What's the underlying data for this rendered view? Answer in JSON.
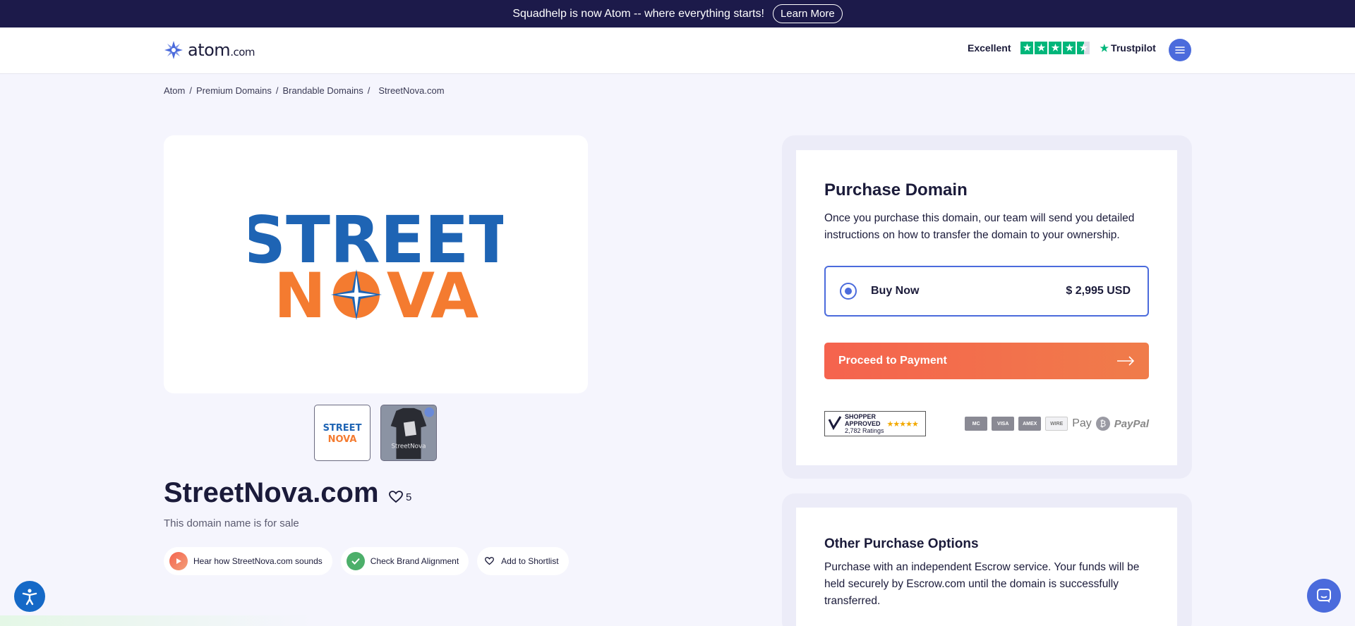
{
  "announcement": {
    "text": "Squadhelp is now Atom -- where everything starts!",
    "button": "Learn More"
  },
  "header": {
    "logo_word": "atom",
    "logo_tld": ".com",
    "rating_label": "Excellent",
    "trustpilot": "Trustpilot",
    "menu_icon": "hamburger-icon"
  },
  "breadcrumb": [
    "Atom",
    "Premium Domains",
    "Brandable Domains",
    "StreetNova.com"
  ],
  "hero": {
    "logo_top": "STREET",
    "logo_bottom_left": "N",
    "logo_bottom_right": "VA"
  },
  "thumbnails": [
    {
      "top": "STREET",
      "bottom": "NOVA"
    },
    {
      "label": "StreetNova"
    }
  ],
  "domain": {
    "name": "StreetNova.com",
    "likes": "5",
    "subtitle": "This domain name is for sale"
  },
  "actions": {
    "hear": "Hear how StreetNova.com sounds",
    "check": "Check Brand Alignment",
    "shortlist": "Add to Shortlist"
  },
  "purchase": {
    "title": "Purchase Domain",
    "description": "Once you purchase this domain, our team will send you detailed instructions on how to transfer the domain to your ownership.",
    "option_label": "Buy Now",
    "option_price": "$ 2,995 USD",
    "proceed": "Proceed to Payment",
    "shopper_line1": "SHOPPER",
    "shopper_line2": "APPROVED",
    "shopper_ratings": "2,782 Ratings",
    "payments": [
      "MC",
      "VISA",
      "AMEX",
      "WIRE"
    ],
    "apple_pay": "Pay",
    "bitcoin": "₿",
    "paypal": "PayPal"
  },
  "other": {
    "title": "Other Purchase Options",
    "description": "Purchase with an independent Escrow service. Your funds will be held securely by Escrow.com until the domain is successfully transferred."
  },
  "colors": {
    "navy": "#1c1a4a",
    "brand_blue": "#4b6bdc",
    "orange": "#f5634e",
    "logo_blue": "#1e64b4",
    "logo_orange": "#f47b30"
  }
}
